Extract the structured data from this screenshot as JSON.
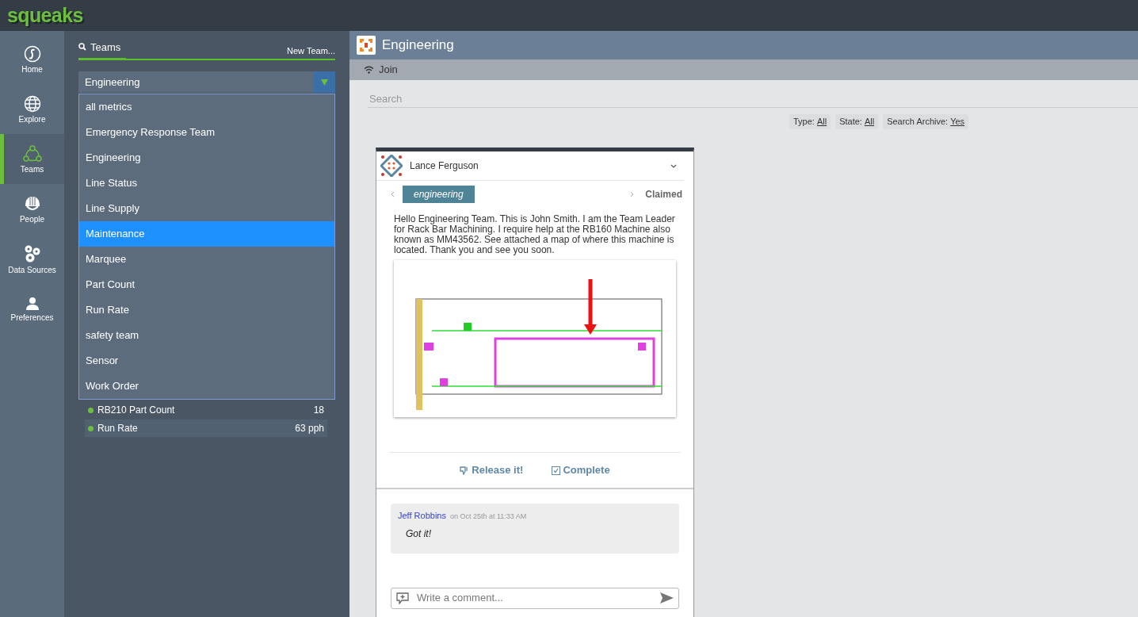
{
  "app": {
    "logo": "squeaks"
  },
  "nav": [
    {
      "label": "Home",
      "selected": false
    },
    {
      "label": "Explore",
      "selected": false
    },
    {
      "label": "Teams",
      "selected": true
    },
    {
      "label": "People",
      "selected": false
    },
    {
      "label": "Data Sources",
      "selected": false
    },
    {
      "label": "Preferences",
      "selected": false
    }
  ],
  "teams_panel": {
    "tab": "Teams",
    "new_team": "New Team...",
    "dropdown": {
      "value": "Engineering",
      "expanded": true,
      "options": [
        {
          "label": "all metrics",
          "highlighted": false
        },
        {
          "label": "Emergency Response Team",
          "highlighted": false
        },
        {
          "label": "Engineering",
          "highlighted": false
        },
        {
          "label": "Line Status",
          "highlighted": false
        },
        {
          "label": "Line Supply",
          "highlighted": false
        },
        {
          "label": "Maintenance",
          "highlighted": true
        },
        {
          "label": "Marquee",
          "highlighted": false
        },
        {
          "label": "Part Count",
          "highlighted": false
        },
        {
          "label": "Run Rate",
          "highlighted": false
        },
        {
          "label": "safety team",
          "highlighted": false
        },
        {
          "label": "Sensor",
          "highlighted": false
        },
        {
          "label": "Work Order",
          "highlighted": false
        }
      ]
    },
    "metrics": [
      {
        "name": "RB210 Part Count",
        "value": "18"
      },
      {
        "name": "Run Rate",
        "value": "63 pph"
      }
    ]
  },
  "main": {
    "title": "Engineering",
    "join": "Join",
    "search": {
      "placeholder": "Search"
    },
    "filters": [
      {
        "label": "Type:",
        "value": "All"
      },
      {
        "label": "State:",
        "value": "All"
      },
      {
        "label": "Search Archive:",
        "value": "Yes"
      }
    ],
    "post": {
      "author": "Lance Ferguson",
      "tag": "engineering",
      "status": "Claimed",
      "body": "Hello Engineering Team. This is John Smith. I am the Team Leader for Rack Bar Machining. I require help at the RB160 Machine also known as MM43562. See attached a map of where this machine is located. Thank you and see you soon.",
      "actions": [
        {
          "kind": "release",
          "label": "Release it!"
        },
        {
          "kind": "complete",
          "label": "Complete"
        }
      ],
      "comments": [
        {
          "author": "Jeff Robbins",
          "time": "on Oct 25th at 11:33 AM",
          "text": "Got it!"
        }
      ],
      "comment_placeholder": "Write a comment..."
    }
  }
}
